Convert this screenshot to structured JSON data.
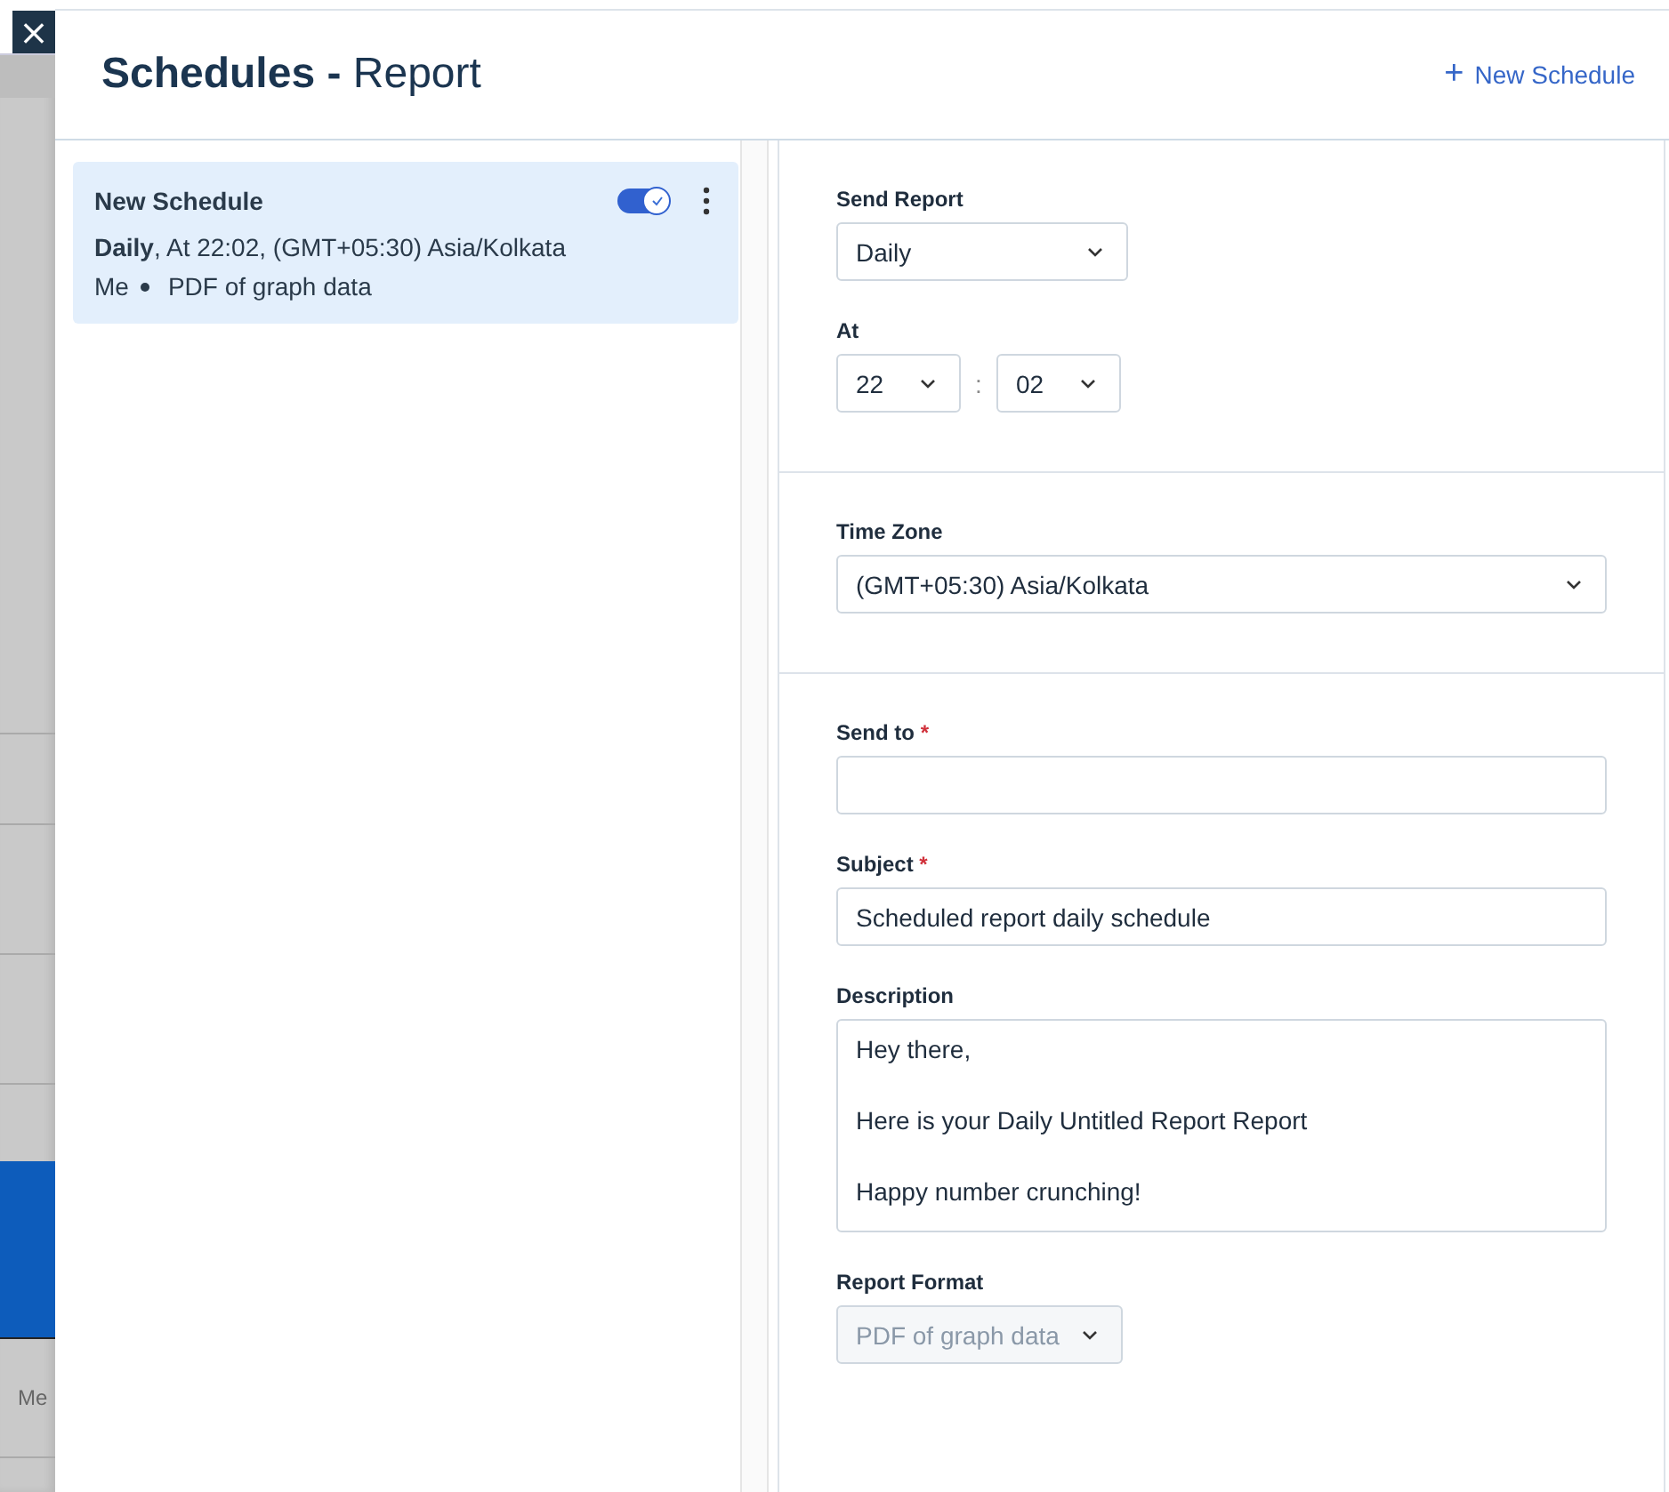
{
  "background": {
    "text": "Me"
  },
  "close_button": {
    "label": "×"
  },
  "header": {
    "title_bold": "Schedules -",
    "title_rest": "Report",
    "action": "New Schedule",
    "action_icon": "+"
  },
  "schedules": [
    {
      "name": "New Schedule",
      "selected": true,
      "on": true,
      "summary": "**Daily**, At 22:02, (GMT+05:30) Asia/Kolkata",
      "recipient": "Me",
      "format": "PDF of graph data"
    }
  ],
  "sections": [
    {
      "fields": [
        {
          "kind": "select",
          "label": "Send Report",
          "value": "Daily"
        },
        {
          "kind": "time",
          "label": "At",
          "hour": "22",
          "separator": ":",
          "minute": "02"
        }
      ]
    },
    {
      "fields": [
        {
          "kind": "wide-select",
          "label": "Time Zone",
          "value": "(GMT+05:30) Asia/Kolkata"
        }
      ]
    },
    {
      "fields": [
        {
          "kind": "input",
          "label": "Send to",
          "required_mark": "*"
        },
        {
          "kind": "input",
          "label": "Subject",
          "required_mark": "*",
          "value": "Scheduled report daily schedule"
        },
        {
          "kind": "textarea",
          "label": "Description",
          "value": "Hey there,\n\nHere is your Daily Untitled Report Report\n\nHappy number crunching!"
        },
        {
          "kind": "select",
          "label": "Report Format",
          "value": "PDF of graph data",
          "disabled": true
        }
      ]
    }
  ]
}
